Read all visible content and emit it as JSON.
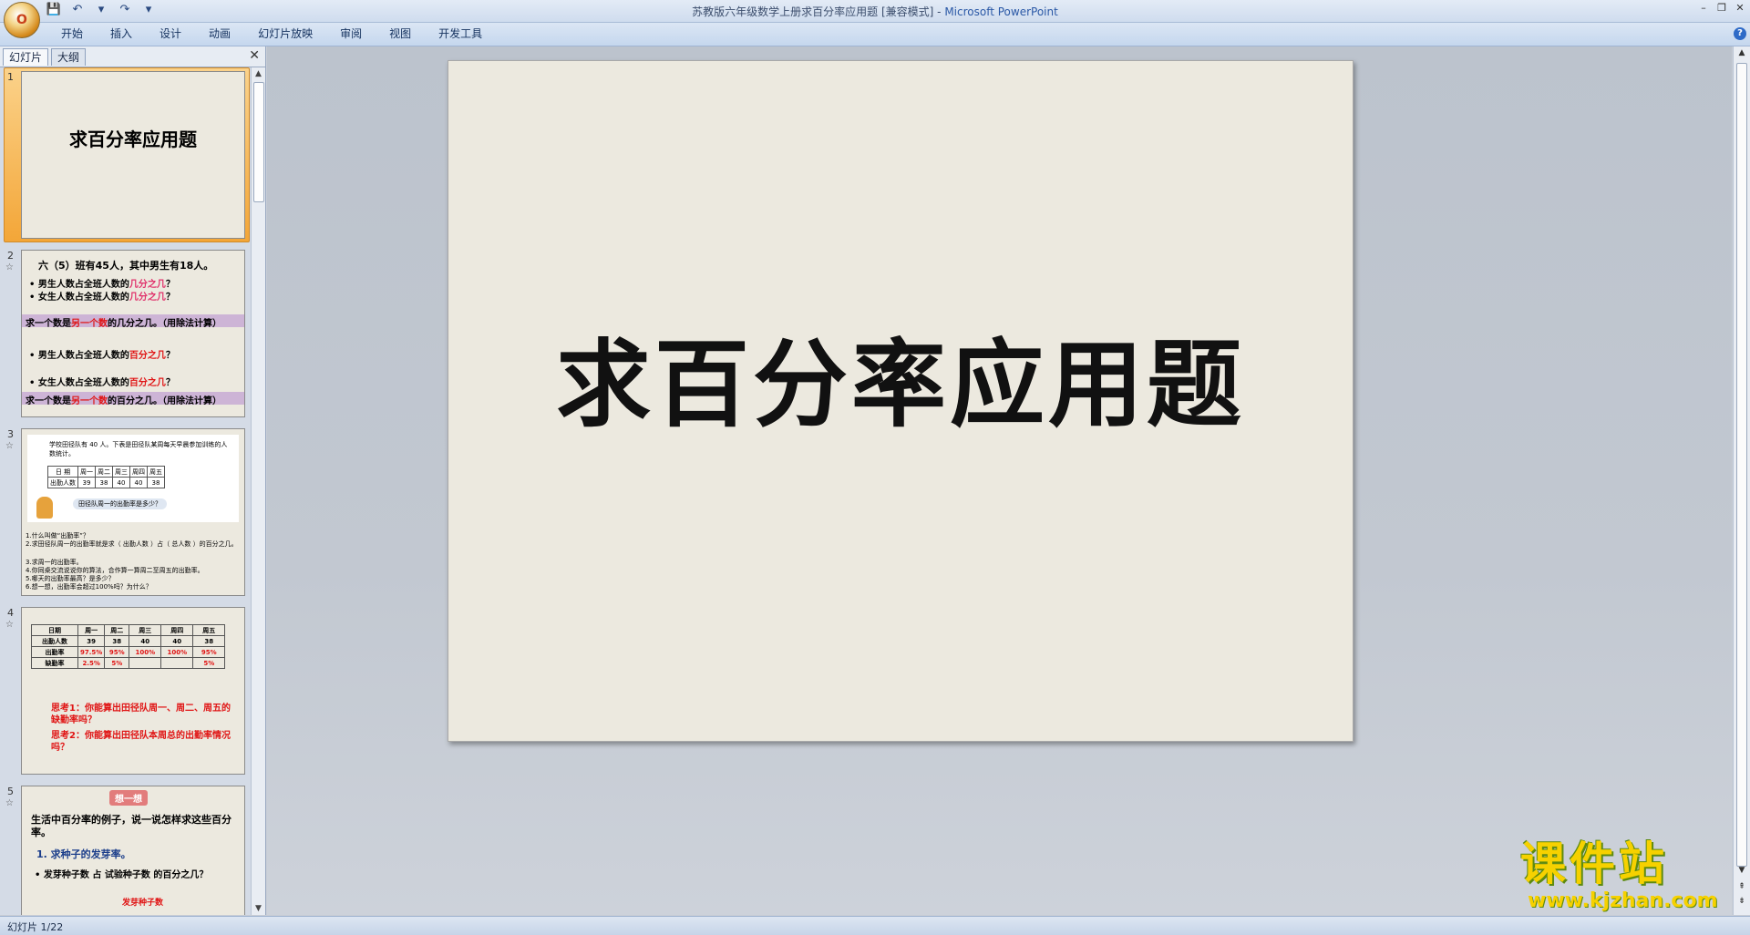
{
  "window": {
    "title": "苏教版六年级数学上册求百分率应用题 [兼容模式]",
    "app_name": "Microsoft PowerPoint",
    "separator": " - ",
    "ctrl_min": "–",
    "ctrl_restore": "❐",
    "ctrl_close": "✕"
  },
  "office_button": {
    "label": "O"
  },
  "quick_access": {
    "save": "💾",
    "undo": "↶",
    "undo_drop": "▾",
    "redo": "↷",
    "customize": "▾"
  },
  "ribbon": {
    "tabs": [
      "开始",
      "插入",
      "设计",
      "动画",
      "幻灯片放映",
      "审阅",
      "视图",
      "开发工具"
    ],
    "help": "?"
  },
  "left_panel": {
    "tab_slides": "幻灯片",
    "tab_outline": "大纲",
    "close": "✕",
    "scroll_up": "▲",
    "scroll_down": "▼",
    "thumbnails": [
      {
        "num": "1",
        "title": "求百分率应用题"
      },
      {
        "num": "2",
        "star": "☆",
        "heading": "六（5）班有45人，其中男生有18人。",
        "q1_a": "• 男生人数占全班人数的",
        "q1_b": "几分之几",
        "q1_c": "？",
        "q2_a": "• 女生人数占全班人数的",
        "q2_b": "几分之几",
        "q2_c": "？",
        "band1_a": "求一个数是",
        "band1_b": "另一个数",
        "band1_c": "的几分之几。（用除法计算）",
        "q3_a": "• 男生人数占全班人数的",
        "q3_b": "百分之几",
        "q3_c": "？",
        "q4_a": "• 女生人数占全班人数的",
        "q4_b": "百分之几",
        "q4_c": "？",
        "band2_a": "求一个数是",
        "band2_b": "另一个数",
        "band2_c": "的百分之几。（用除法计算）"
      },
      {
        "num": "3",
        "star": "☆",
        "intro": "学校田径队有 40 人。下表是田径队某周每天早晨参加训练的人数统计。",
        "table_head": [
          "日 期",
          "周一",
          "周二",
          "周三",
          "周四",
          "周五"
        ],
        "table_row": [
          "出勤人数",
          "39",
          "38",
          "40",
          "40",
          "38"
        ],
        "bubble": "田径队周一的出勤率是多少？",
        "lines": [
          "1.什么叫做“出勤率”？",
          "2.求田径队周一的出勤率就是求（  出勤人数  ）占（  总人数  ）的百分之几。",
          "3.求周一的出勤率。",
          "4.你同桌交流说说你的算法，合作算一算周二至周五的出勤率。",
          "5.哪天的出勤率最高？是多少？",
          "6.想一想，出勤率会超过100%吗？为什么？"
        ]
      },
      {
        "num": "4",
        "star": "☆",
        "table_head": [
          "日期",
          "周一",
          "周二",
          "周三",
          "周四",
          "周五"
        ],
        "row1": [
          "出勤人数",
          "39",
          "38",
          "40",
          "40",
          "38"
        ],
        "row2": [
          "出勤率",
          "97.5%",
          "95%",
          "100%",
          "100%",
          "95%"
        ],
        "row3": [
          "缺勤率",
          "2.5%",
          "5%",
          "",
          "",
          "5%"
        ],
        "think1": "思考1：你能算出田径队周一、周二、周五的缺勤率吗？",
        "think2": "思考2：你能算出田径队本周总的出勤率情况吗？"
      },
      {
        "num": "5",
        "star": "☆",
        "badge": "想一想",
        "intro": "生活中百分率的例子，说一说怎样求这些百分率。",
        "item1": "1. 求种子的发芽率。",
        "item2": "• 发芽种子数 占 试验种子数 的百分之几？",
        "item3": "发芽种子数"
      }
    ]
  },
  "slide": {
    "title": "求百分率应用题"
  },
  "status": {
    "text": "幻灯片 1/22"
  },
  "watermark": {
    "cn": "课件站",
    "url": "www.kjzhan.com"
  },
  "scroll": {
    "up": "▲",
    "down": "▼",
    "prev": "⇞",
    "next": "⇟"
  }
}
